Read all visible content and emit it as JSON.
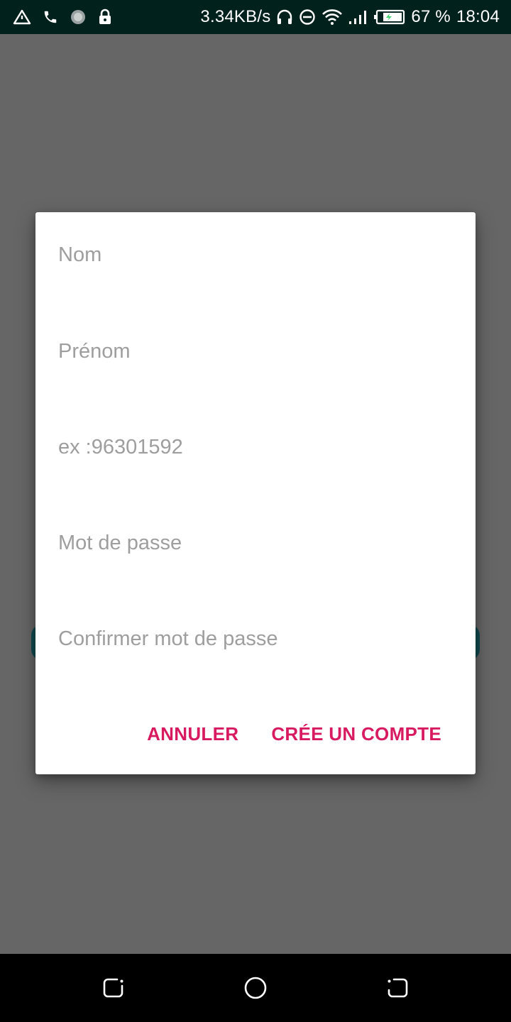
{
  "status_bar": {
    "net_speed": "3.34KB/s",
    "battery_percent": "67 %",
    "time": "18:04",
    "icons": [
      "warning-triangle-icon",
      "phone-icon",
      "spinner-icon",
      "lock-icon",
      "headphones-icon",
      "do-not-disturb-icon",
      "wifi-icon",
      "signal-icon",
      "battery-icon"
    ]
  },
  "dialog": {
    "fields": {
      "nom_placeholder": "Nom",
      "prenom_placeholder": "Prénom",
      "phone_placeholder": "ex :96301592",
      "password_placeholder": "Mot de passe",
      "confirm_placeholder": "Confirmer mot de passe"
    },
    "actions": {
      "cancel_label": "ANNULER",
      "create_label": "CRÉE UN COMPTE"
    },
    "accent_color": "#d81b60"
  },
  "nav_bar": {
    "icons": [
      "back-icon",
      "home-icon",
      "recent-apps-icon"
    ]
  }
}
